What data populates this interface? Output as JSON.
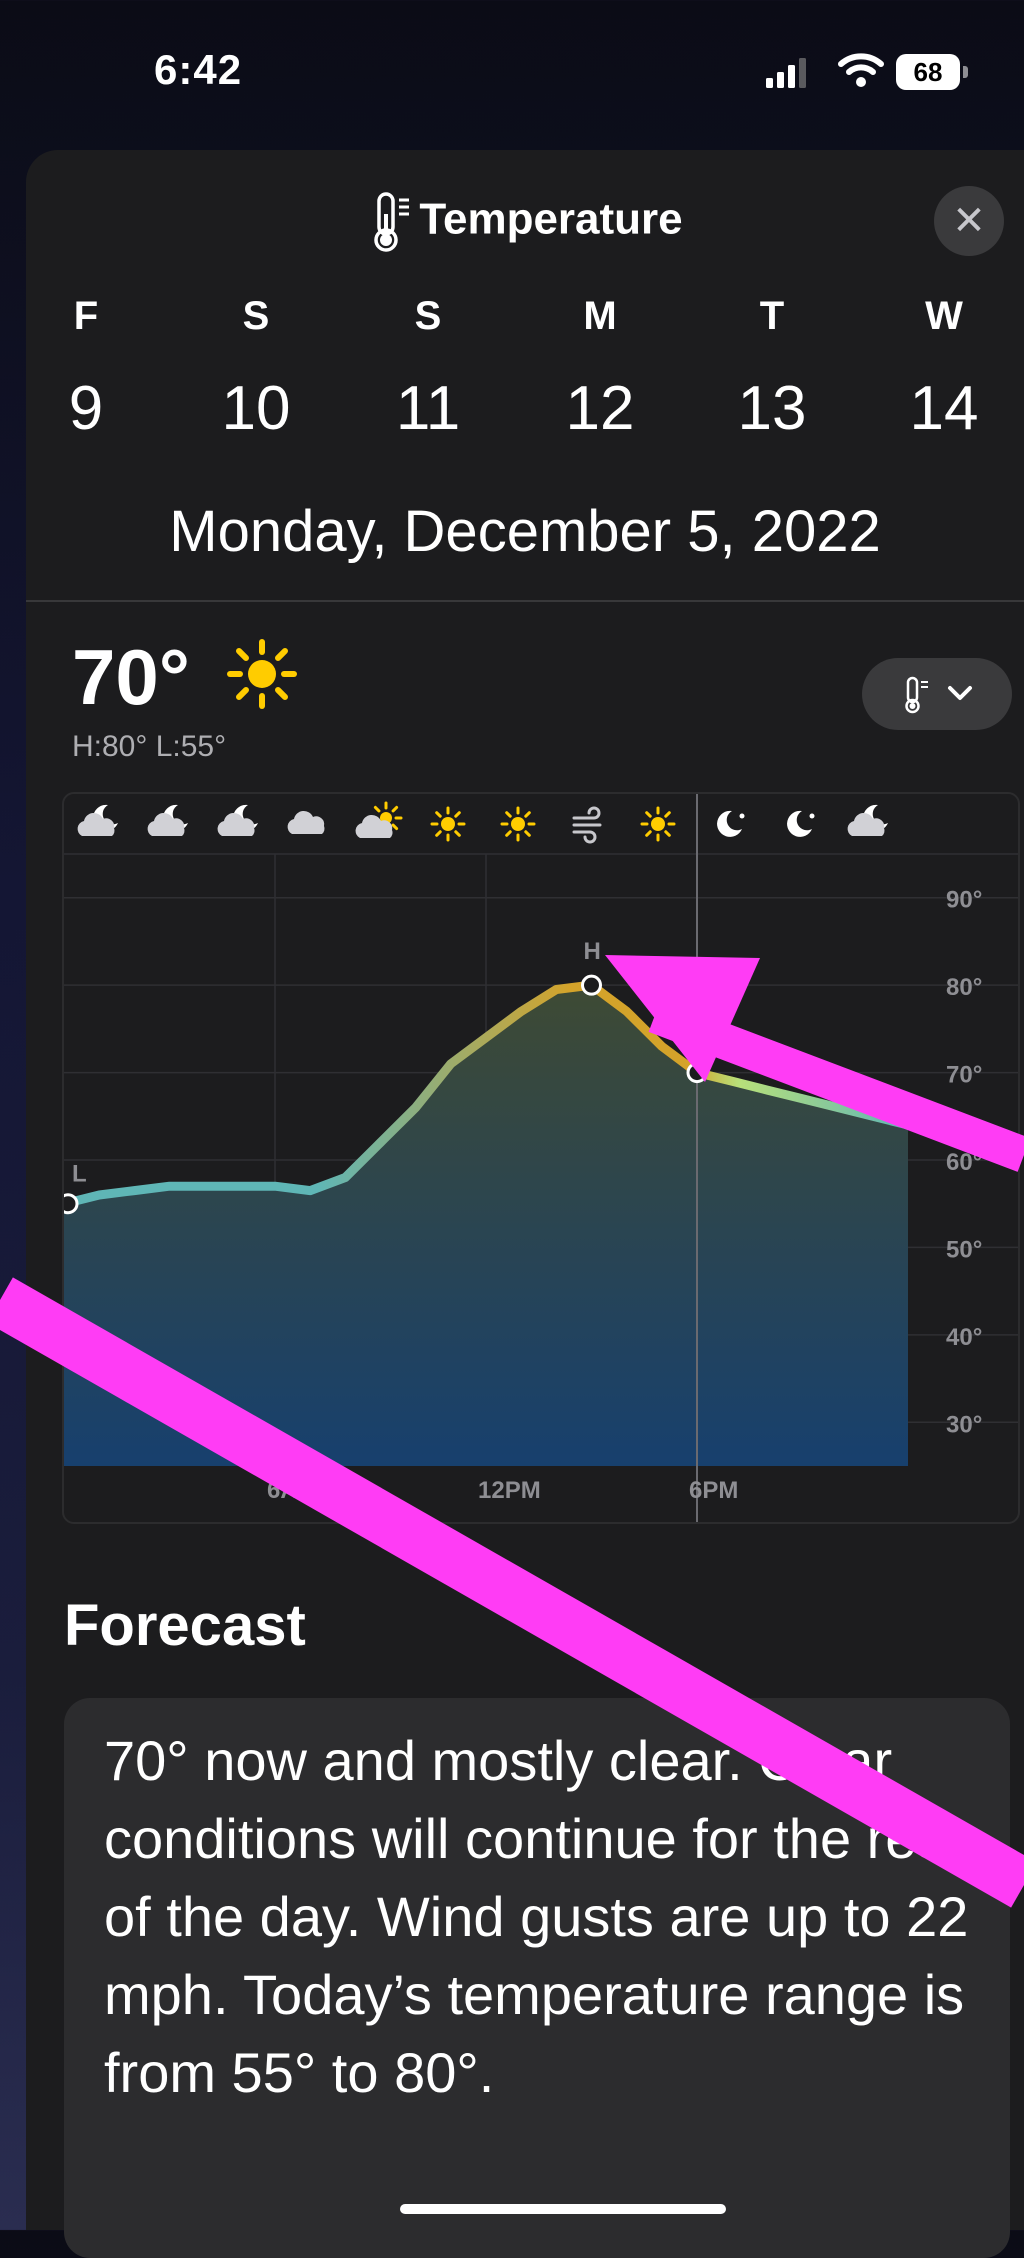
{
  "status": {
    "time": "6:42",
    "battery": "68"
  },
  "sheet": {
    "title": "Temperature",
    "close_icon": "xmark-icon"
  },
  "days": [
    {
      "letter": "F",
      "num": "9"
    },
    {
      "letter": "S",
      "num": "10"
    },
    {
      "letter": "S",
      "num": "11"
    },
    {
      "letter": "M",
      "num": "12"
    },
    {
      "letter": "T",
      "num": "13"
    },
    {
      "letter": "W",
      "num": "14"
    }
  ],
  "date_heading": "Monday, December 5, 2022",
  "current": {
    "temp": "70°",
    "hilo": "H:80° L:55°",
    "condition_icon": "sun-icon"
  },
  "metric_button": {
    "icon": "thermometer-icon"
  },
  "forecast": {
    "title": "Forecast",
    "text": "70° now and mostly clear. Clear conditions will continue for the rest of the day. Wind gusts are up to 22 mph. Today’s temperature range is from 55° to 80°."
  },
  "chart_data": {
    "type": "area",
    "x": [
      0,
      1,
      2,
      3,
      4,
      5,
      6,
      7,
      8,
      9,
      10,
      11,
      12,
      13,
      14,
      15,
      16,
      17,
      18,
      19,
      20,
      21,
      22,
      23,
      24
    ],
    "y": [
      55,
      56,
      56.5,
      57,
      57,
      57,
      57,
      56.5,
      58,
      62,
      66,
      71,
      74,
      77,
      79.5,
      80,
      77,
      73,
      70,
      69,
      68,
      67,
      66,
      65,
      64
    ],
    "x_tick_labels": [
      "6AM",
      "12PM",
      "6PM"
    ],
    "y_tick_labels": [
      "90°",
      "80°",
      "70°",
      "60°",
      "50°",
      "40°",
      "30°"
    ],
    "ylim": [
      25,
      95
    ],
    "high_label": "H",
    "low_label": "L",
    "hourly_icons": [
      "cloud-moon-icon",
      "cloud-moon-icon",
      "cloud-moon-icon",
      "cloud-icon",
      "cloud-sun-icon",
      "sun-icon",
      "sun-icon",
      "wind-icon",
      "sun-icon",
      "moon-star-icon",
      "moon-star-icon",
      "cloud-moon-icon"
    ],
    "colors": {
      "low": "#5fb6b6",
      "high": "#d4a32a",
      "now": "#b8e07a",
      "fill_top": "#3e4a34",
      "fill_bottom": "#17406e"
    }
  }
}
